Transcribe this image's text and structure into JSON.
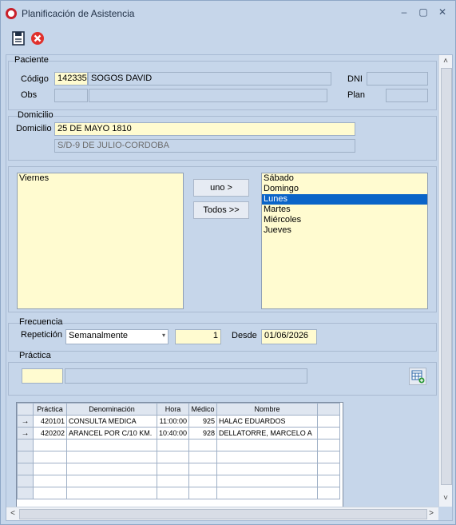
{
  "window": {
    "title": "Planificación de Asistencia"
  },
  "toolbar": {
    "save_icon": "save-icon",
    "cancel_icon": "cancel-icon"
  },
  "paciente": {
    "group_label": "Paciente",
    "codigo_label": "Código",
    "codigo": "142335",
    "nombre": "SOGOS DAVID",
    "obs_label": "Obs",
    "dni_label": "DNI",
    "plan_label": "Plan"
  },
  "domicilio": {
    "group_label": "Domicilio",
    "label": "Domicilio",
    "calle": "25 DE MAYO 1810",
    "detalle": "S/D-9 DE JULIO-CORDOBA"
  },
  "dias": {
    "left": [
      "Viernes"
    ],
    "right": [
      "Sábado",
      "Domingo",
      "Lunes",
      "Martes",
      "Miércoles",
      "Jueves"
    ],
    "selected": "Lunes",
    "btn_uno": "uno >",
    "btn_todos": "Todos >>"
  },
  "frecuencia": {
    "group_label": "Frecuencia",
    "repeticion_label": "Repetición",
    "repeticion": "Semanalmente",
    "cantidad": "1",
    "desde_label": "Desde",
    "desde": "01/06/2026"
  },
  "practica": {
    "group_label": "Práctica"
  },
  "table": {
    "headers": [
      "Práctica",
      "Denominación",
      "Hora",
      "Médico",
      "Nombre"
    ],
    "rows": [
      [
        "420101",
        "CONSULTA MEDICA",
        "11:00:00",
        "925",
        "HALAC EDUARDOS"
      ],
      [
        "420202",
        "ARANCEL POR C/10 KM.",
        "10:40:00",
        "928",
        "DELLATORRE, MARCELO A"
      ]
    ]
  }
}
